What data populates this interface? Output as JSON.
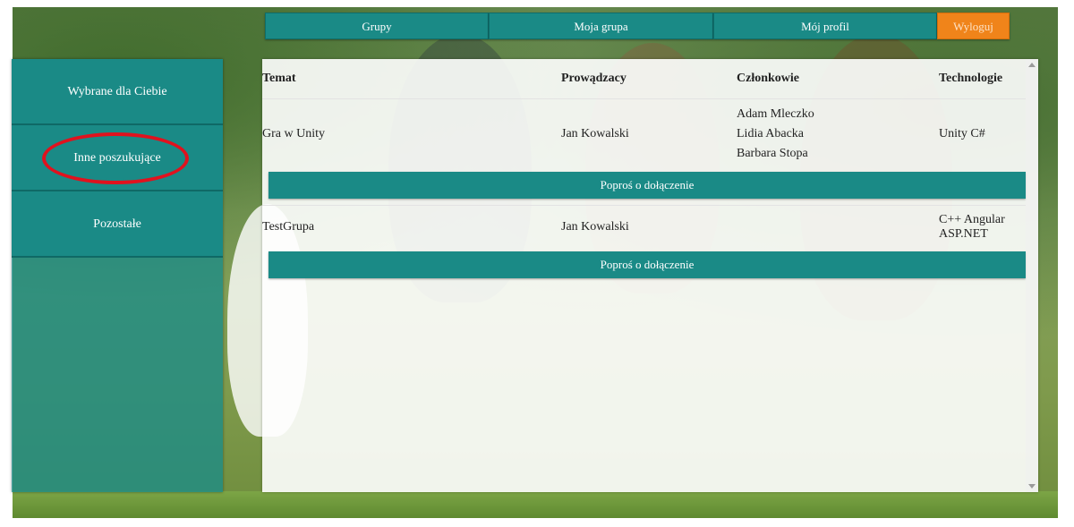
{
  "nav": {
    "grupy": "Grupy",
    "moja_grupa": "Moja grupa",
    "moj_profil": "Mój profil",
    "wyloguj": "Wyloguj"
  },
  "sidebar": {
    "items": [
      {
        "label": "Wybrane dla Ciebie"
      },
      {
        "label": "Inne poszukujące"
      },
      {
        "label": "Pozostałe"
      }
    ]
  },
  "table": {
    "headers": [
      "Temat",
      "Prowądzacy",
      "Członkowie",
      "Technologie"
    ],
    "rows": [
      {
        "temat": "Gra w Unity",
        "prowadzacy": "Jan Kowalski",
        "members": [
          "Adam Mleczko",
          "Lidia Abacka",
          "Barbara Stopa"
        ],
        "technologie": "Unity C#",
        "join_label": "Poproś o dołączenie"
      },
      {
        "temat": "TestGrupa",
        "prowadzacy": "Jan Kowalski",
        "members": [],
        "technologie": "C++ Angular ASP.NET",
        "join_label": "Poproś o dołączenie"
      }
    ]
  },
  "colors": {
    "teal": "#1a8a86",
    "orange": "#f0841a",
    "highlight_circle": "#e0121e"
  }
}
